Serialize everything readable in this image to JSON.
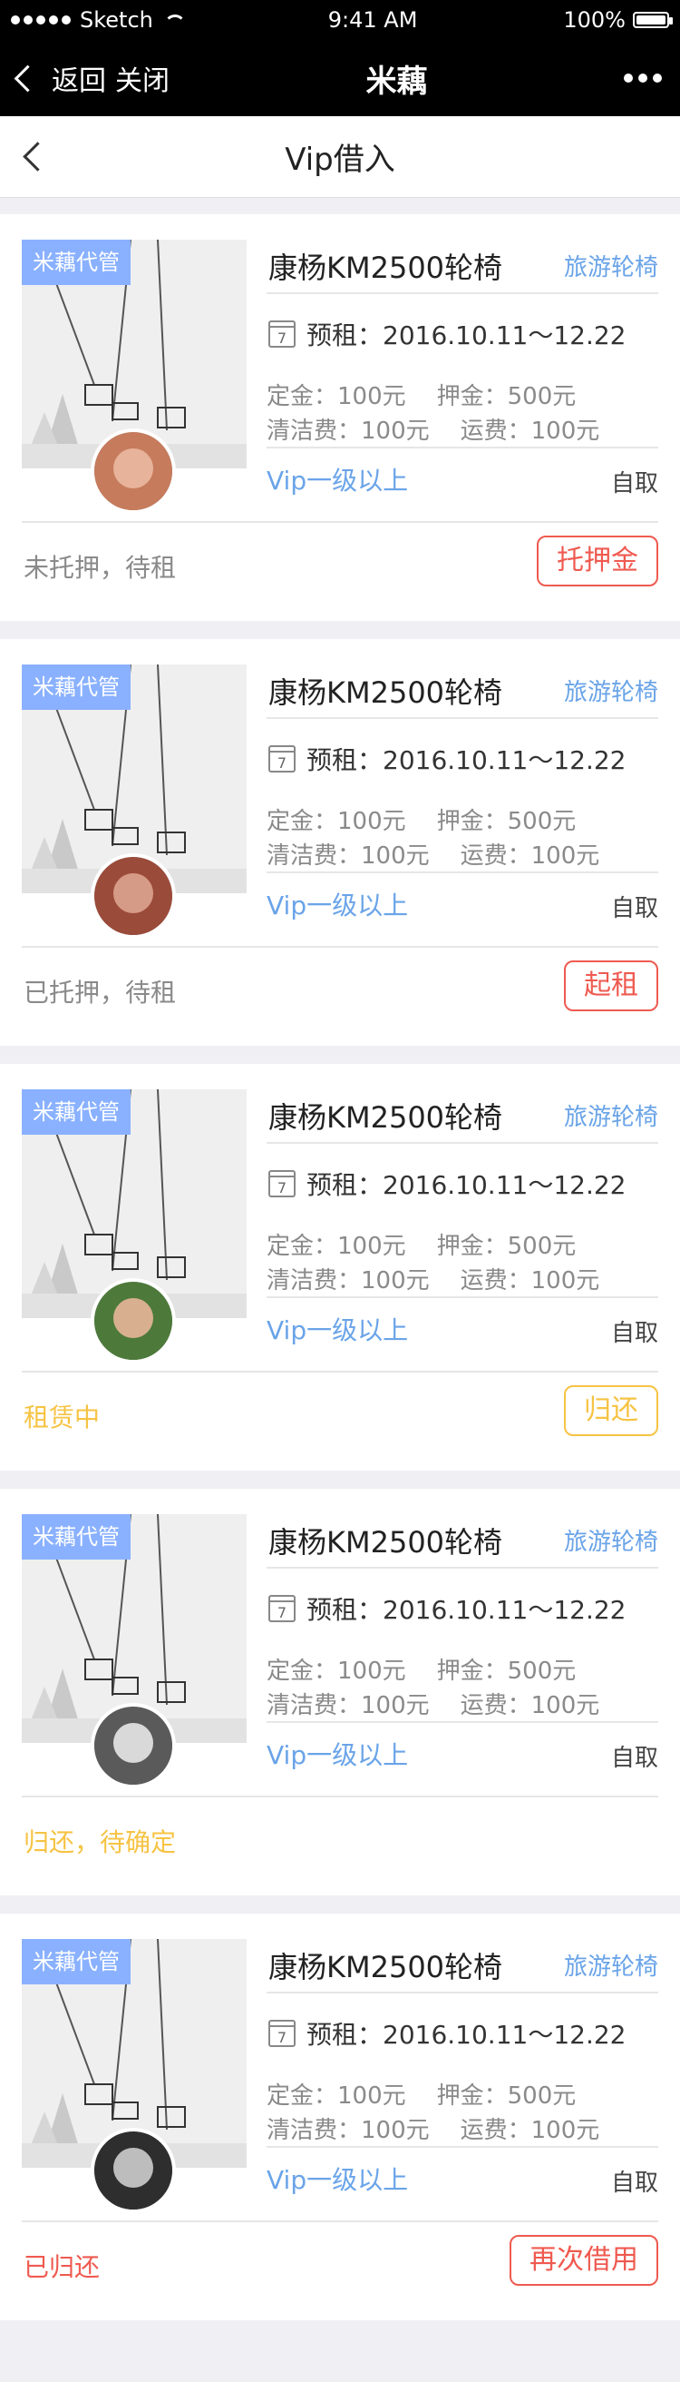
{
  "status_bar": {
    "carrier": "Sketch",
    "time": "9:41 AM",
    "battery": "100%"
  },
  "top_bar": {
    "back_label": "返回",
    "close_label": "关闭",
    "title": "米藕"
  },
  "nav": {
    "title": "Vip借入"
  },
  "cards": [
    {
      "tag": "米藕代管",
      "name": "康杨KM2500轮椅",
      "category": "旅游轮椅",
      "date": "预租：2016.10.11～12.22",
      "deposit": "定金：100元",
      "pledge": "押金：500元",
      "cleaning": "清洁费：100元",
      "shipping": "运费：100元",
      "vip": "Vip一级以上",
      "pickup": "自取",
      "status": "未托押，待租",
      "status_color": "#8a8a8a",
      "button": "托押金",
      "button_color": "#ef5a50"
    },
    {
      "tag": "米藕代管",
      "name": "康杨KM2500轮椅",
      "category": "旅游轮椅",
      "date": "预租：2016.10.11～12.22",
      "deposit": "定金：100元",
      "pledge": "押金：500元",
      "cleaning": "清洁费：100元",
      "shipping": "运费：100元",
      "vip": "Vip一级以上",
      "pickup": "自取",
      "status": "已托押，待租",
      "status_color": "#8a8a8a",
      "button": "起租",
      "button_color": "#ef5a50"
    },
    {
      "tag": "米藕代管",
      "name": "康杨KM2500轮椅",
      "category": "旅游轮椅",
      "date": "预租：2016.10.11～12.22",
      "deposit": "定金：100元",
      "pledge": "押金：500元",
      "cleaning": "清洁费：100元",
      "shipping": "运费：100元",
      "vip": "Vip一级以上",
      "pickup": "自取",
      "status": "租赁中",
      "status_color": "#f6c343",
      "button": "归还",
      "button_color": "#f6c343"
    },
    {
      "tag": "米藕代管",
      "name": "康杨KM2500轮椅",
      "category": "旅游轮椅",
      "date": "预租：2016.10.11～12.22",
      "deposit": "定金：100元",
      "pledge": "押金：500元",
      "cleaning": "清洁费：100元",
      "shipping": "运费：100元",
      "vip": "Vip一级以上",
      "pickup": "自取",
      "status": "归还，待确定",
      "status_color": "#f6c343",
      "button": "",
      "button_color": "#f6c343"
    },
    {
      "tag": "米藕代管",
      "name": "康杨KM2500轮椅",
      "category": "旅游轮椅",
      "date": "预租：2016.10.11～12.22",
      "deposit": "定金：100元",
      "pledge": "押金：500元",
      "cleaning": "清洁费：100元",
      "shipping": "运费：100元",
      "vip": "Vip一级以上",
      "pickup": "自取",
      "status": "已归还",
      "status_color": "#ef5a50",
      "button": "再次借用",
      "button_color": "#ef5a50"
    }
  ]
}
